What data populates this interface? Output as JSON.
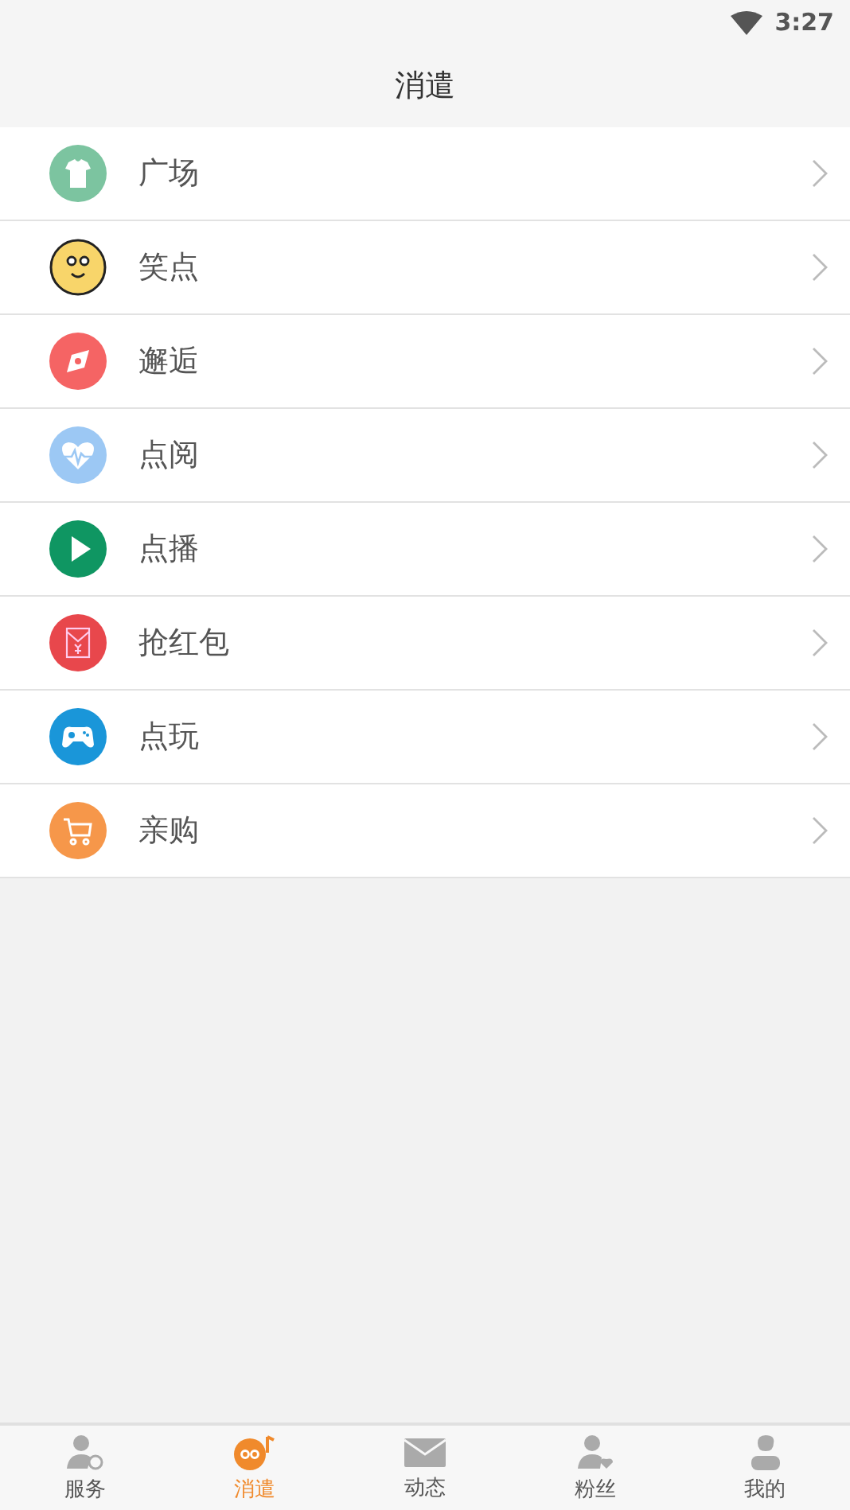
{
  "status_bar": {
    "time": "3:27"
  },
  "header": {
    "title": "消遣"
  },
  "items": [
    {
      "label": "广场",
      "kind": "shirt",
      "color": "#7cc4a0"
    },
    {
      "label": "笑点",
      "kind": "smiley",
      "color": "#f8d56a"
    },
    {
      "label": "邂逅",
      "kind": "compass",
      "color": "#f56464"
    },
    {
      "label": "点阅",
      "kind": "heartbeat",
      "color": "#9cc8f4"
    },
    {
      "label": "点播",
      "kind": "play",
      "color": "#0f9662"
    },
    {
      "label": "抢红包",
      "kind": "envelope",
      "color": "#e8474c"
    },
    {
      "label": "点玩",
      "kind": "gamepad",
      "color": "#1a96d9"
    },
    {
      "label": "亲购",
      "kind": "cart",
      "color": "#f6974a"
    }
  ],
  "tabs": [
    {
      "label": "服务",
      "kind": "user-sync",
      "selected": false
    },
    {
      "label": "消遣",
      "kind": "disc-note",
      "selected": true
    },
    {
      "label": "动态",
      "kind": "mail",
      "selected": false
    },
    {
      "label": "粉丝",
      "kind": "user-heart",
      "selected": false
    },
    {
      "label": "我的",
      "kind": "user",
      "selected": false
    }
  ]
}
